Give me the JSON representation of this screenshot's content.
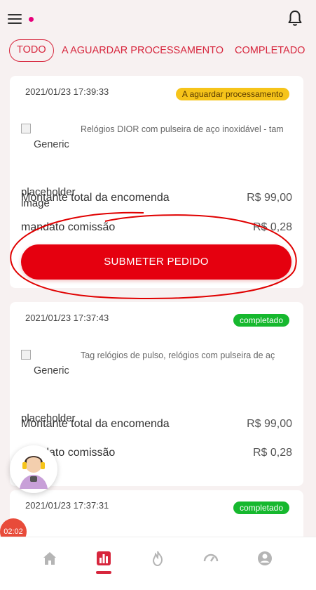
{
  "colors": {
    "accent": "#d7263d",
    "button": "#e5000f",
    "pending": "#f6c41a",
    "done": "#16b82e",
    "annotation": "#e00000"
  },
  "header": {
    "menu_icon": "hamburger-menu-icon",
    "bell_icon": "bell-icon"
  },
  "tabs": [
    {
      "label": "TODO",
      "active": true
    },
    {
      "label": "A AGUARDAR PROCESSAMENTO",
      "active": false
    },
    {
      "label": "COMPLETADO",
      "active": false
    }
  ],
  "orders": [
    {
      "date": "2021/01/23 17:39:33",
      "status": "A aguardar processamento",
      "image_alt": "Generic",
      "product_name": "Relógios DIOR com pulseira de aço inoxidável - tam",
      "overlay_text": "placeholder image",
      "total_label": "Montante total da encomenda",
      "total_value": "R$ 99,00",
      "commission_label": "mandato comissão",
      "commission_value": "R$ 0,28",
      "submit_label": "SUBMETER PEDIDO"
    },
    {
      "date": "2021/01/23 17:37:43",
      "status": "completado",
      "image_alt": "Generic",
      "product_name": "Tag relógios de pulso, relógios com pulseira de aç",
      "overlay_text": "placeholder",
      "total_label": "Montante total da encomenda",
      "total_value": "R$ 99,00",
      "commission_label": "mandato comissão",
      "commission_value": "R$ 0,28"
    },
    {
      "date": "2021/01/23 17:37:31",
      "status": "completado"
    }
  ],
  "timer": "02:02",
  "bottom_nav": [
    {
      "icon": "home-icon",
      "active": false
    },
    {
      "icon": "orders-chart-icon",
      "active": true
    },
    {
      "icon": "flame-icon",
      "active": false
    },
    {
      "icon": "speedometer-icon",
      "active": false
    },
    {
      "icon": "user-icon",
      "active": false
    }
  ]
}
